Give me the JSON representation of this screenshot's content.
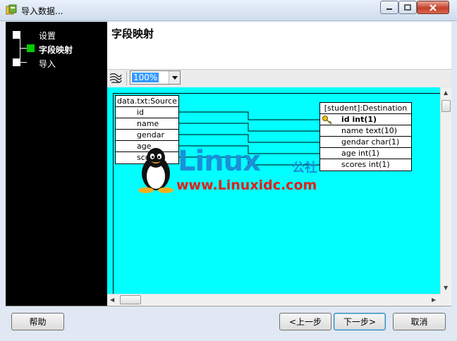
{
  "window": {
    "title": "导入数据..."
  },
  "wizard": {
    "steps": [
      {
        "label": "设置",
        "active": false
      },
      {
        "label": "字段映射",
        "active": true
      },
      {
        "label": "导入",
        "active": false
      }
    ],
    "current_step_color": "#00cc00"
  },
  "header": {
    "title": "字段映射"
  },
  "toolbar": {
    "zoom": "100%"
  },
  "mapping": {
    "source": {
      "title": "data.txt:Source",
      "fields": [
        "id",
        "name",
        "gendar",
        "age",
        "scores"
      ]
    },
    "destination": {
      "title": "[student]:Destination",
      "fields": [
        "id  int(1)",
        "name  text(10)",
        "gendar  char(1)",
        "age  int(1)",
        "scores  int(1)"
      ],
      "primary_key": "id  int(1)"
    },
    "canvas_color": "#00ffff"
  },
  "watermark": {
    "brand": "Linux",
    "cn": "公社",
    "url": "www.Linuxidc.com"
  },
  "buttons": {
    "help": "帮助",
    "prev": "<上一步",
    "next": "下一步>",
    "cancel": "取消"
  }
}
